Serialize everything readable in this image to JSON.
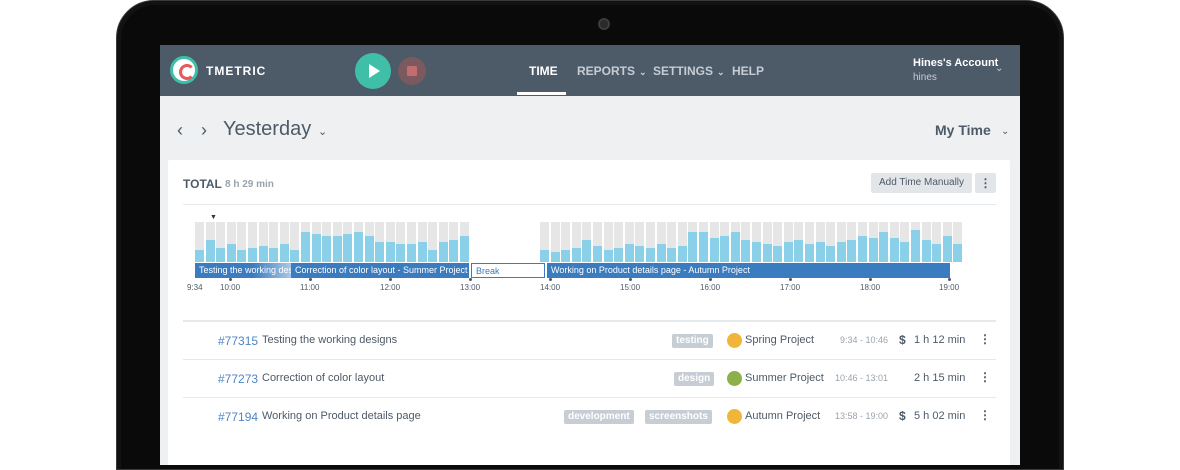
{
  "app": {
    "brand": "TMETRIC"
  },
  "nav": {
    "time": "TIME",
    "reports": "REPORTS",
    "settings": "SETTINGS",
    "help": "HELP"
  },
  "account": {
    "name": "Hines's Account",
    "user": "hines"
  },
  "date_bar": {
    "title": "Yesterday",
    "view": "My Time"
  },
  "summary": {
    "total_label": "TOTAL",
    "total_value": "8 h 29 min",
    "add_button": "Add Time Manually"
  },
  "timeline": {
    "activity_left": [
      0.3,
      0.55,
      0.35,
      0.45,
      0.3,
      0.35,
      0.4,
      0.35,
      0.45,
      0.3,
      0.75,
      0.7,
      0.65,
      0.65,
      0.7,
      0.75,
      0.65,
      0.5,
      0.5,
      0.45,
      0.45,
      0.5,
      0.3,
      0.5,
      0.55,
      0.65
    ],
    "activity_right": [
      0.3,
      0.25,
      0.3,
      0.35,
      0.55,
      0.4,
      0.3,
      0.35,
      0.45,
      0.4,
      0.35,
      0.45,
      0.35,
      0.4,
      0.75,
      0.75,
      0.6,
      0.65,
      0.75,
      0.55,
      0.5,
      0.45,
      0.4,
      0.5,
      0.55,
      0.45,
      0.5,
      0.4,
      0.5,
      0.55,
      0.65,
      0.6,
      0.75,
      0.6,
      0.5,
      0.8,
      0.55,
      0.45,
      0.65,
      0.45
    ],
    "segments": [
      {
        "label": "Testing the working designs"
      },
      {
        "label": "Correction of color layout - Summer Project"
      },
      {
        "label": "Break"
      },
      {
        "label": "Working on Product details page - Autumn Project"
      }
    ],
    "ticks": [
      "9:34",
      "10:00",
      "11:00",
      "12:00",
      "13:00",
      "14:00",
      "15:00",
      "16:00",
      "17:00",
      "18:00",
      "19:00"
    ]
  },
  "entries": [
    {
      "id": "#77315",
      "description": "Testing the working designs",
      "tags": [
        "testing"
      ],
      "project": "Spring Project",
      "project_color": "#f0b63c",
      "time_range": "9:34 - 10:46",
      "billable": "$",
      "duration": "1 h 12 min"
    },
    {
      "id": "#77273",
      "description": "Correction of color layout",
      "tags": [
        "design"
      ],
      "project": "Summer Project",
      "project_color": "#8cb04a",
      "time_range": "10:46 - 13:01",
      "billable": "",
      "duration": "2 h 15 min"
    },
    {
      "id": "#77194",
      "description": "Working on Product details page",
      "tags": [
        "development",
        "screenshots"
      ],
      "project": "Autumn Project",
      "project_color": "#f0b63c",
      "time_range": "13:58 - 19:00",
      "billable": "$",
      "duration": "5 h 02 min"
    }
  ],
  "colors": {
    "header": "#4d5a68",
    "accent": "#3fbfa8",
    "link": "#4f85c2",
    "bar": "#8ad0e8",
    "segment": "#3a7cbf"
  }
}
